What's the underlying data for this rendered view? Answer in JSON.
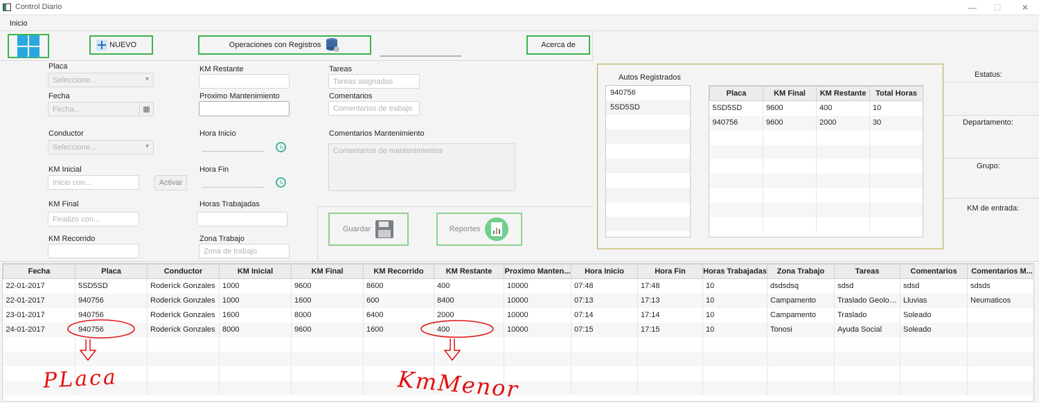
{
  "window": {
    "title": "Control Diario",
    "minimize": "—",
    "maximize": "☐",
    "close": "✕"
  },
  "menu": {
    "inicio": "Inicio"
  },
  "toolbar": {
    "nuevo": "NUEVO",
    "operaciones": "Operaciones con Registros",
    "acerca": "Acerca de"
  },
  "form": {
    "placa_label": "Placa",
    "placa_placeholder": "Seleccione...",
    "fecha_label": "Fecha",
    "fecha_placeholder": "Fecha...",
    "conductor_label": "Conductor",
    "conductor_placeholder": "Seleccione...",
    "km_inicial_label": "KM Inicial",
    "km_inicial_placeholder": "Inicio con...",
    "activar": "Activar",
    "km_final_label": "KM Final",
    "km_final_placeholder": "Finalizo con...",
    "km_recorrido_label": "KM Recorrido",
    "km_restante_label": "KM Restante",
    "proximo_mant_label": "Proximo Mantenimiento",
    "hora_inicio_label": "Hora Inicio",
    "hora_fin_label": "Hora Fin",
    "horas_trabajadas_label": "Horas Trabajadas",
    "zona_trabajo_label": "Zona Trabajo",
    "zona_trabajo_placeholder": "Zona de trabajo",
    "tareas_label": "Tareas",
    "tareas_placeholder": "Tareas asignadas",
    "comentarios_label": "Comentarios",
    "comentarios_placeholder": "Comentarios de trabajo",
    "comentarios_mant_label": "Comentarios Mantenimiento",
    "comentarios_mant_placeholder": "Comentarios de mantenimientos"
  },
  "actions": {
    "guardar": "Guardar",
    "reportes": "Reportes"
  },
  "autos": {
    "title": "Autos Registrados",
    "list": [
      "940756",
      "5SD5SD"
    ],
    "headers": [
      "Placa",
      "KM Final",
      "KM Restante",
      "Total Horas"
    ],
    "rows": [
      [
        "5SD5SD",
        "9600",
        "400",
        "10"
      ],
      [
        "940756",
        "9600",
        "2000",
        "30"
      ]
    ]
  },
  "status": {
    "estatus": "Estatus:",
    "departamento": "Departamento:",
    "grupo": "Grupo:",
    "km_entrada": "KM de entrada:"
  },
  "table": {
    "headers": [
      "Fecha",
      "Placa",
      "Conductor",
      "KM Inicial",
      "KM Final",
      "KM Recorrido",
      "KM Restante",
      "Proximo Manten...",
      "Hora Inicio",
      "Hora Fin",
      "Horas Trabajadas",
      "Zona Trabajo",
      "Tareas",
      "Comentarios",
      "Comentarios M..."
    ],
    "rows": [
      [
        "22-01-2017",
        "5SD5SD",
        "Roderíck Gonzales",
        "1000",
        "9600",
        "8600",
        "400",
        "10000",
        "07:48",
        "17:48",
        "10",
        "dsdsdsq",
        "sdsd",
        "sdsd",
        "sdsds"
      ],
      [
        "22-01-2017",
        "940756",
        "Roderíck Gonzales",
        "1000",
        "1600",
        "600",
        "8400",
        "10000",
        "07:13",
        "17:13",
        "10",
        "Campamento",
        "Traslado Geologos",
        "Lluvias",
        "Neumaticos"
      ],
      [
        "23-01-2017",
        "940756",
        "Roderíck Gonzales",
        "1600",
        "8000",
        "6400",
        "2000",
        "10000",
        "07:14",
        "17:14",
        "10",
        "Campamento",
        "Traslado",
        "Soleado",
        ""
      ],
      [
        "24-01-2017",
        "940756",
        "Roderíck Gonzales",
        "8000",
        "9600",
        "1600",
        "400",
        "10000",
        "07:15",
        "17:15",
        "10",
        "Tonosi",
        "Ayuda Social",
        "Soleado",
        ""
      ]
    ]
  },
  "annotations": {
    "placa": "PLaca",
    "km_menor": "KmMenor"
  },
  "colors": {
    "accent_green": "#3cb44b",
    "annotation_red": "#e01010",
    "panel_border": "#b5a642"
  }
}
